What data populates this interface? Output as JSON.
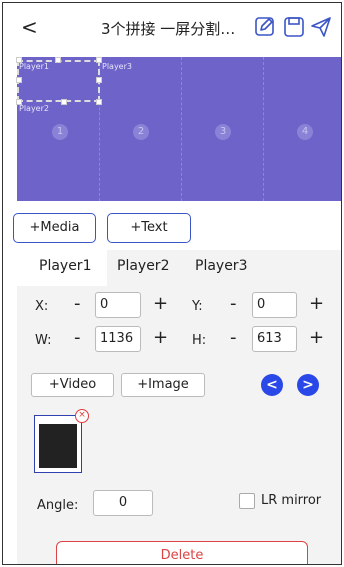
{
  "header": {
    "back_glyph": "<",
    "title": "3个拼接 一屏分割…",
    "icons": [
      "edit-icon",
      "save-icon",
      "send-icon"
    ]
  },
  "canvas": {
    "cell_numbers": [
      "1",
      "2",
      "3",
      "4"
    ],
    "players_on_canvas": [
      "Player1",
      "Player2",
      "Player3"
    ],
    "bg_color": "#6e63c9"
  },
  "media_buttons": {
    "media": "+Media",
    "text": "+Text"
  },
  "tabs": [
    "Player1",
    "Player2",
    "Player3"
  ],
  "position": {
    "x_label": "X:",
    "y_label": "Y:",
    "w_label": "W:",
    "h_label": "H:",
    "x": "0",
    "y": "0",
    "w": "1136",
    "h": "613",
    "minus": "-",
    "plus": "+"
  },
  "content_buttons": {
    "video": "+Video",
    "image": "+Image"
  },
  "nav": {
    "prev": "<",
    "next": ">"
  },
  "angle": {
    "label": "Angle:",
    "value": "0"
  },
  "mirror": {
    "label": "LR mirror"
  },
  "delete_label": "Delete",
  "colors": {
    "accent": "#3a55c6",
    "nav_blue": "#2a48e8",
    "danger": "#d94545"
  }
}
